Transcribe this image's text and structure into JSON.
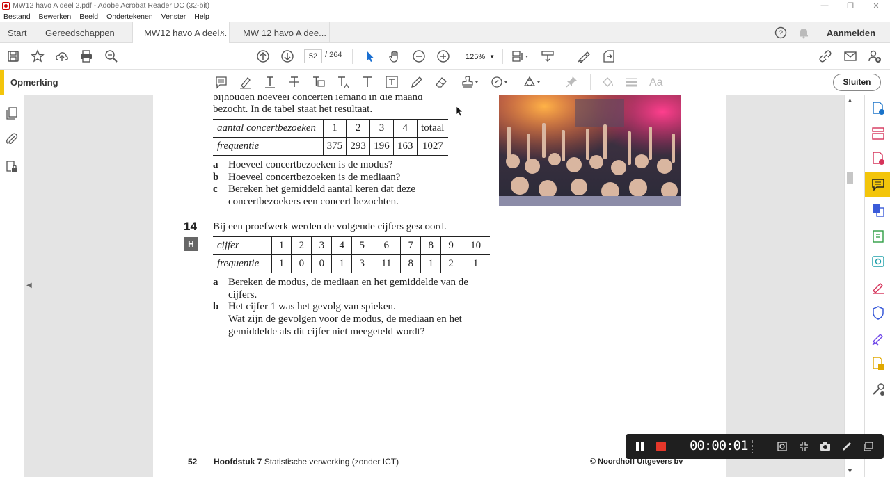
{
  "window": {
    "title": "MW12 havo A deel 2.pdf - Adobe Acrobat Reader DC (32-bit)"
  },
  "menu": [
    "Bestand",
    "Bewerken",
    "Beeld",
    "Ondertekenen",
    "Venster",
    "Help"
  ],
  "tabs": {
    "start": "Start",
    "tools": "Gereedschappen",
    "doc1": "MW12 havo A deel...",
    "doc2": "MW 12 havo A dee...",
    "close": "×",
    "signin": "Aanmelden"
  },
  "nav": {
    "page": "52",
    "total": "/ 264",
    "zoom": "125%"
  },
  "comment": {
    "label": "Opmerking",
    "close": "Sluiten"
  },
  "doc": {
    "intro1": "bijhouden hoeveel concerten iemand in die maand",
    "intro2": "bezocht. In de tabel staat het resultaat.",
    "t1_header": [
      "aantal concertbezoeken",
      "1",
      "2",
      "3",
      "4",
      "totaal"
    ],
    "t1_row": [
      "frequentie",
      "375",
      "293",
      "196",
      "163",
      "1027"
    ],
    "q13": [
      {
        "letter": "a",
        "lines": [
          "Hoeveel concertbezoeken is de modus?"
        ]
      },
      {
        "letter": "b",
        "lines": [
          "Hoeveel concertbezoeken is de mediaan?"
        ]
      },
      {
        "letter": "c",
        "lines": [
          "Bereken het gemiddeld aantal keren dat deze",
          "concertbezoekers een concert bezochten."
        ]
      }
    ],
    "ex_num": "14",
    "ex_badge": "H",
    "ex_text": "Bij een proefwerk werden de volgende cijfers gescoord.",
    "t2_header": [
      "cijfer",
      "1",
      "2",
      "3",
      "4",
      "5",
      "6",
      "7",
      "8",
      "9",
      "10"
    ],
    "t2_row": [
      "frequentie",
      "1",
      "0",
      "0",
      "1",
      "3",
      "11",
      "8",
      "1",
      "2",
      "1"
    ],
    "q14": [
      {
        "letter": "a",
        "lines": [
          "Bereken de modus, de mediaan en het gemiddelde van de",
          "cijfers."
        ]
      },
      {
        "letter": "b",
        "lines": [
          "Het cijfer 1 was het gevolg van spieken.",
          "Wat zijn de gevolgen voor de modus, de mediaan en het",
          "gemiddelde als dit cijfer niet meegeteld wordt?"
        ]
      }
    ],
    "footer_page": "52",
    "footer_chapter": "Hoofdstuk 7",
    "footer_title": "Statistische verwerking (zonder ICT)",
    "footer_copyright": "© Noordhoff Uitgevers bv"
  },
  "recorder": {
    "time": "00:00:01"
  }
}
